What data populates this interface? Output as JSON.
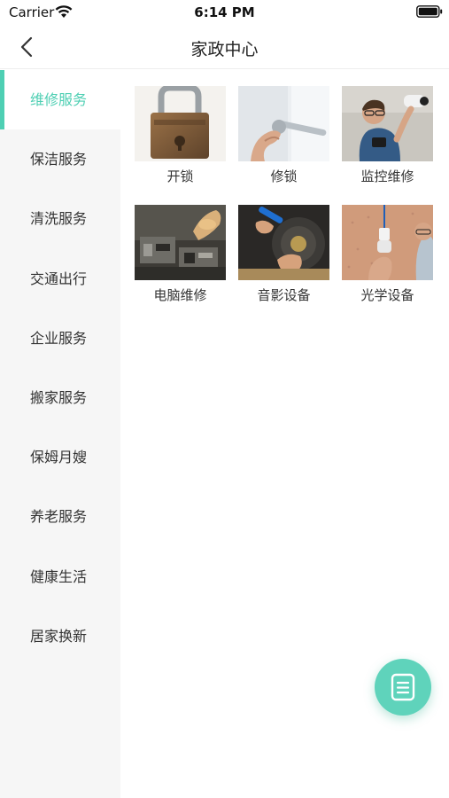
{
  "status_bar": {
    "carrier": "Carrier",
    "time": "6:14 PM"
  },
  "nav": {
    "title": "家政中心",
    "back_icon": "chevron-left-icon"
  },
  "colors": {
    "accent": "#4ecfb3",
    "sidebar_bg": "#f6f6f6",
    "fab": "#5fd3bb"
  },
  "sidebar": {
    "active_index": 0,
    "items": [
      {
        "label": "维修服务"
      },
      {
        "label": "保洁服务"
      },
      {
        "label": "清洗服务"
      },
      {
        "label": "交通出行"
      },
      {
        "label": "企业服务"
      },
      {
        "label": "搬家服务"
      },
      {
        "label": "保姆月嫂"
      },
      {
        "label": "养老服务"
      },
      {
        "label": "健康生活"
      },
      {
        "label": "居家换新"
      }
    ]
  },
  "services": [
    {
      "label": "开锁",
      "image": "padlock-photo"
    },
    {
      "label": "修锁",
      "image": "door-handle-repair-photo"
    },
    {
      "label": "监控维修",
      "image": "cctv-camera-install-photo"
    },
    {
      "label": "电脑维修",
      "image": "circuit-board-repair-photo"
    },
    {
      "label": "音影设备",
      "image": "speaker-repair-photo"
    },
    {
      "label": "光学设备",
      "image": "light-fixture-install-photo"
    }
  ],
  "fab": {
    "icon": "document-list-icon"
  }
}
